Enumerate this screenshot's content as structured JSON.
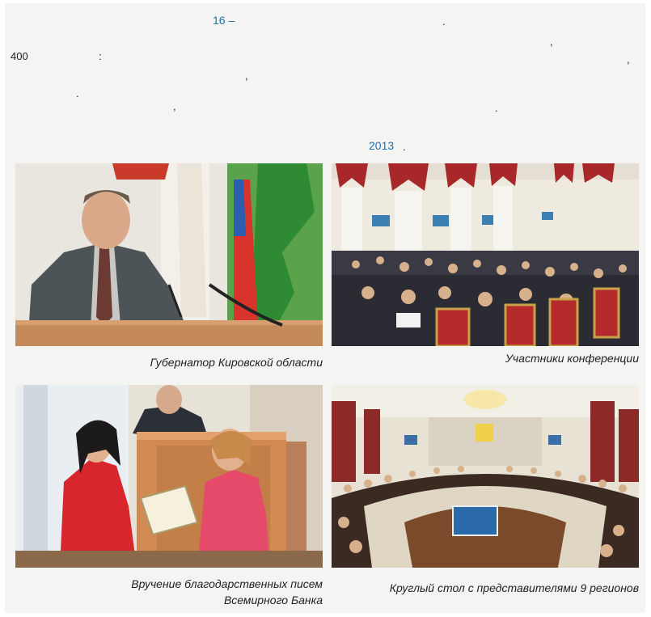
{
  "text": {
    "line1_number": "16 –",
    "line1_dot": ".",
    "line2_comma": ",",
    "line3_number": "400",
    "line3_colon": ":",
    "line3_comma": ",",
    "line4_comma": ",",
    "line5_dot": ".",
    "line6_comma": ",",
    "line6_dot": ".",
    "year": "2013",
    "year_dot": "."
  },
  "photos": [
    {
      "caption": "Губернатор Кировской области",
      "icon": "governor-speaking-photo"
    },
    {
      "caption": "Участники конференции",
      "icon": "conference-audience-photo"
    },
    {
      "caption_line1": "Вручение благодарственных писем",
      "caption_line2": "Всемирного Банка",
      "icon": "award-ceremony-photo"
    },
    {
      "caption": "Круглый стол с представителями 9 регионов",
      "icon": "round-table-photo"
    }
  ],
  "colors": {
    "accent_blue": "#1f6fb3",
    "panel_bg": "#f4f4f2"
  }
}
